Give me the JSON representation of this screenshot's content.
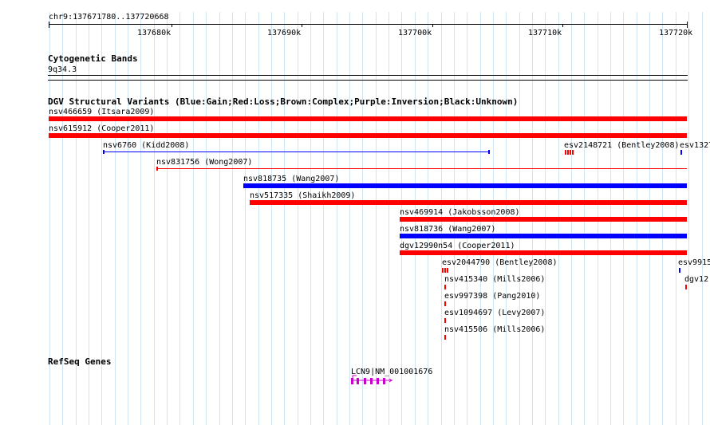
{
  "ruler": {
    "position_label": "chr9:137671780..137720668",
    "ticks": [
      "137680k",
      "137690k",
      "137700k",
      "137710k",
      "137720k"
    ]
  },
  "cyto": {
    "title": "Cytogenetic Bands",
    "band": "9q34.3"
  },
  "dgv": {
    "title": "DGV Structural Variants (Blue:Gain;Red:Loss;Brown:Complex;Purple:Inversion;Black:Unknown)",
    "colors": {
      "gain": "#0000ff",
      "loss": "#ff0000"
    },
    "features": [
      {
        "label": "nsv466659 (Itsara2009)",
        "type": "loss"
      },
      {
        "label": "nsv615912 (Cooper2011)",
        "type": "loss"
      },
      {
        "label": "nsv6760 (Kidd2008)",
        "type": "gain"
      },
      {
        "label": "esv2148721 (Bentley2008)",
        "type": "loss"
      },
      {
        "label": "esv1327",
        "type": "gain"
      },
      {
        "label": "nsv831756 (Wong2007)",
        "type": "loss"
      },
      {
        "label": "nsv818735 (Wang2007)",
        "type": "gain"
      },
      {
        "label": "nsv517335 (Shaikh2009)",
        "type": "loss"
      },
      {
        "label": "nsv469914 (Jakobsson2008)",
        "type": "loss"
      },
      {
        "label": "nsv818736 (Wang2007)",
        "type": "gain"
      },
      {
        "label": "dgv12990n54 (Cooper2011)",
        "type": "loss"
      },
      {
        "label": "esv2044790 (Bentley2008)",
        "type": "loss"
      },
      {
        "label": "esv9915",
        "type": "gain"
      },
      {
        "label": "nsv415340 (Mills2006)",
        "type": "loss"
      },
      {
        "label": "dgv12",
        "type": "loss"
      },
      {
        "label": "esv997398 (Pang2010)",
        "type": "loss"
      },
      {
        "label": "esv1094697 (Levy2007)",
        "type": "loss"
      },
      {
        "label": "nsv415506 (Mills2006)",
        "type": "loss"
      }
    ]
  },
  "refseq": {
    "title": "RefSeq Genes",
    "gene_label": "LCN9|NM_001001676",
    "color": "#cc00cc"
  }
}
